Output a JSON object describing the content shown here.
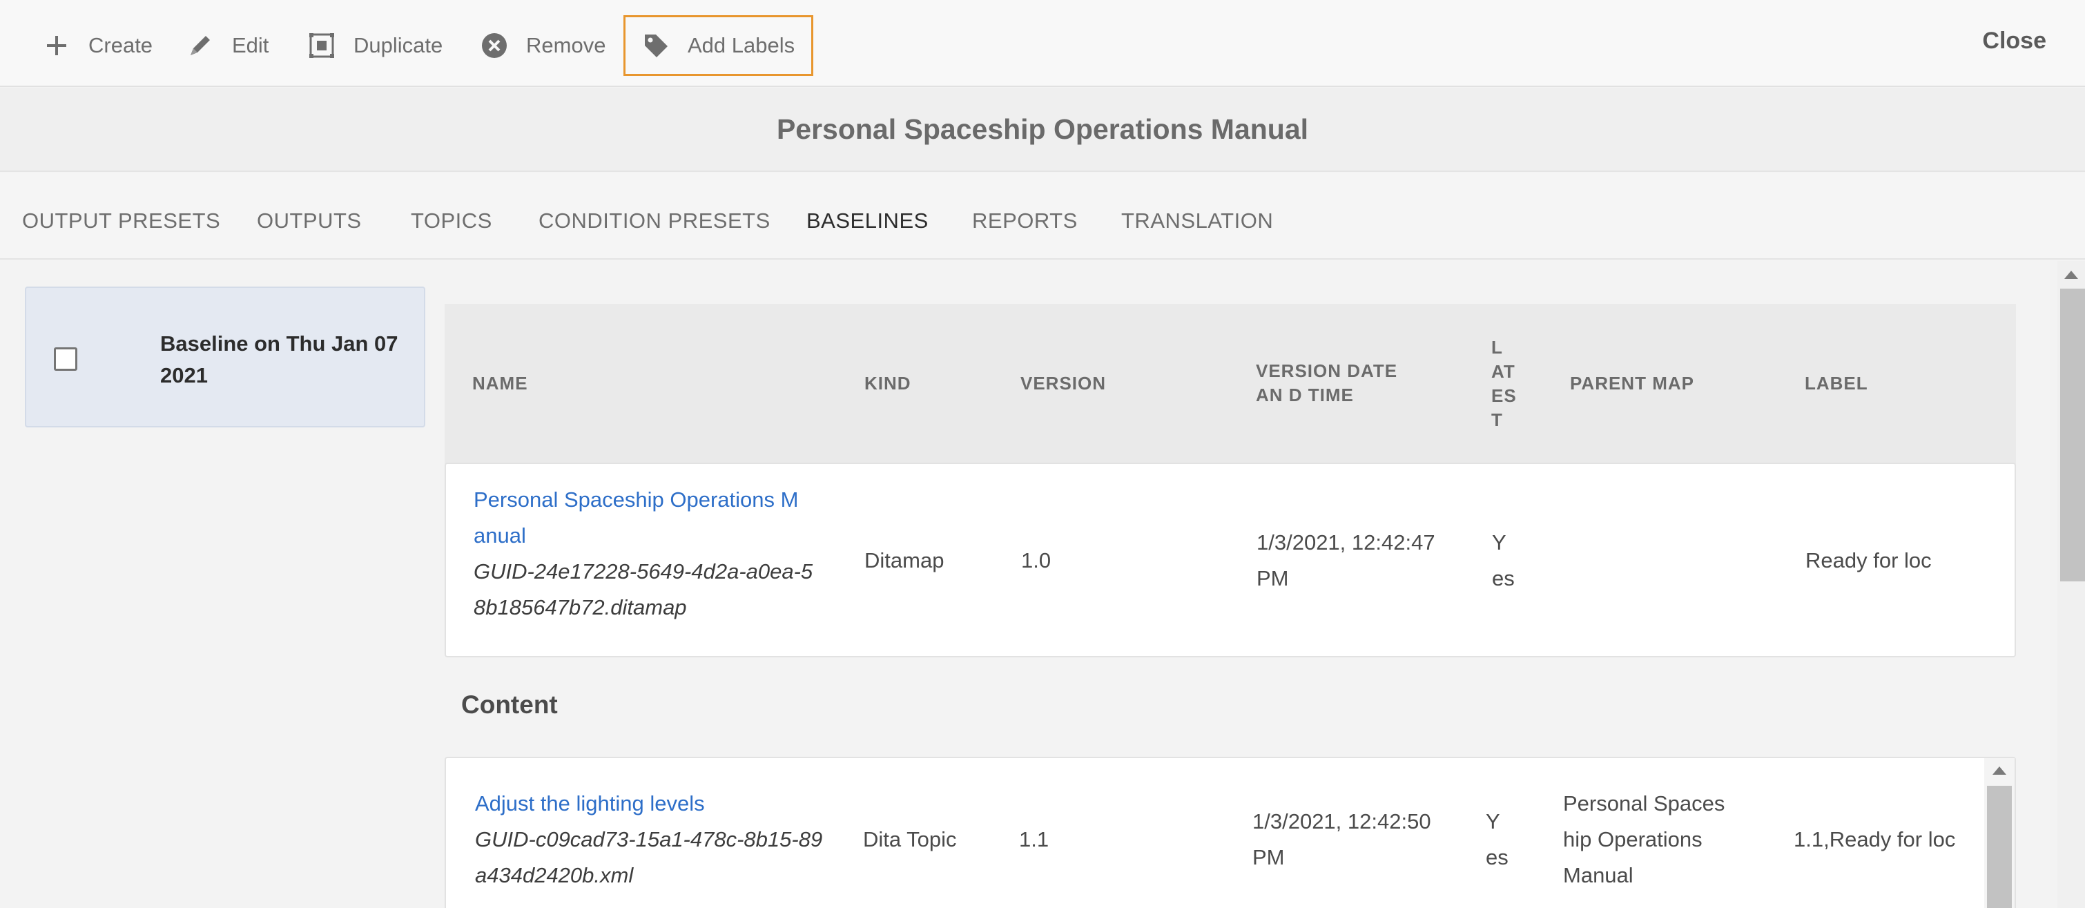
{
  "toolbar": {
    "create": "Create",
    "edit": "Edit",
    "duplicate": "Duplicate",
    "remove": "Remove",
    "add_labels": "Add Labels",
    "close": "Close"
  },
  "title": "Personal Spaceship Operations Manual",
  "tabs": [
    "OUTPUT PRESETS",
    "OUTPUTS",
    "TOPICS",
    "CONDITION PRESETS",
    "BASELINES",
    "REPORTS",
    "TRANSLATION"
  ],
  "active_tab": "BASELINES",
  "baseline": {
    "label": "Baseline on Thu Jan 07 2021",
    "checked": false
  },
  "columns": {
    "name": "NAME",
    "kind": "KIND",
    "version": "VERSION",
    "version_date": "VERSION DATE AN D TIME",
    "latest": "L AT ES T",
    "parent_map": "PARENT MAP",
    "label": "LABEL"
  },
  "map_row": {
    "name_line1": "Personal Spaceship Operations M",
    "name_line2": "anual",
    "guid_line1": "GUID-24e17228-5649-4d2a-a0ea-5",
    "guid_line2": "8b185647b72.ditamap",
    "kind": "Ditamap",
    "version": "1.0",
    "date_line1": "1/3/2021, 12:42:47",
    "date_line2": "PM",
    "latest_line1": "Y",
    "latest_line2": "es",
    "parent_map": "",
    "label": "Ready for loc"
  },
  "content_heading": "Content",
  "content_rows": [
    {
      "name": "Adjust the lighting levels",
      "guid_line1": "GUID-c09cad73-15a1-478c-8b15-89",
      "guid_line2": "a434d2420b.xml",
      "kind": "Dita Topic",
      "version": "1.1",
      "date_line1": "1/3/2021, 12:42:50",
      "date_line2": "PM",
      "latest_line1": "Y",
      "latest_line2": "es",
      "parent_line1": "Personal Spaces",
      "parent_line2": "hip Operations",
      "parent_line3": "Manual",
      "label": "1.1,Ready for loc"
    }
  ],
  "colors": {
    "accent_focus": "#e8962e",
    "link": "#2d6ec8",
    "selected_bg": "#e4e9f2"
  },
  "icons": [
    "plus-icon",
    "pencil-icon",
    "duplicate-icon",
    "remove-circle-icon",
    "tag-icon"
  ]
}
